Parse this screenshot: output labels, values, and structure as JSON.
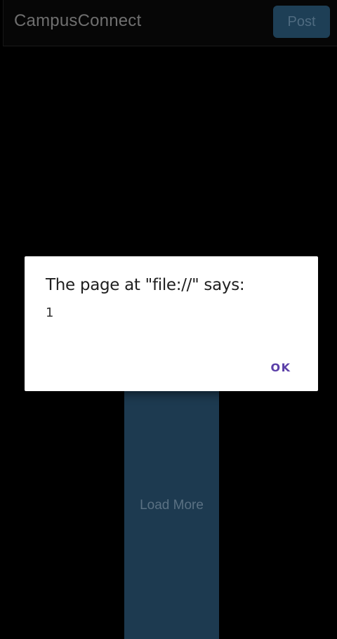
{
  "header": {
    "app_title": "CampusConnect",
    "post_label": "Post"
  },
  "main": {
    "load_more_label": "Load More"
  },
  "dialog": {
    "title": "The page at \"file://\" says:",
    "message": "1",
    "ok_label": "OK"
  },
  "colors": {
    "background": "#000000",
    "accent": "#1d3a50",
    "dialog_button": "#5b3fa8"
  }
}
